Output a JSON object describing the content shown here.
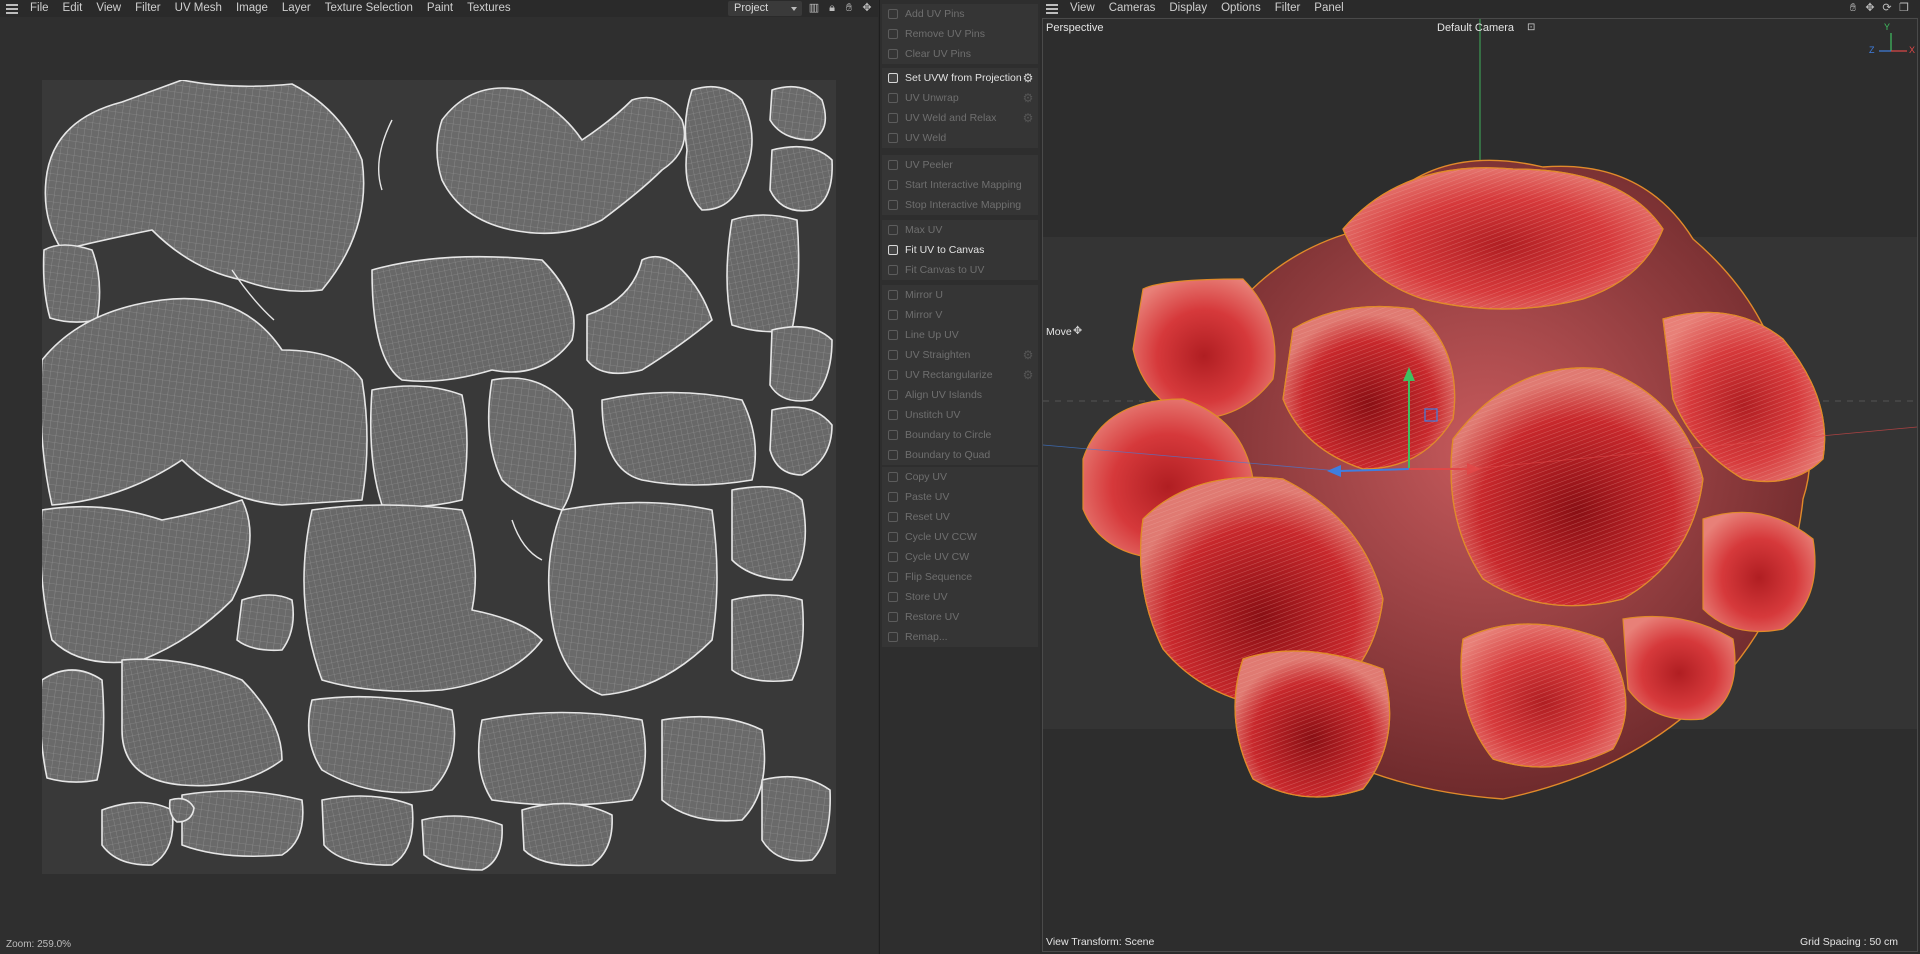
{
  "uv_editor": {
    "menu": [
      "File",
      "Edit",
      "View",
      "Filter",
      "UV Mesh",
      "Image",
      "Layer",
      "Texture Selection",
      "Paint",
      "Textures"
    ],
    "project_select": "Project",
    "status": "Zoom: 259.0%"
  },
  "commands": {
    "group1": [
      {
        "label": "Add UV Pins",
        "enabled": false
      },
      {
        "label": "Remove UV Pins",
        "enabled": false
      },
      {
        "label": "Clear UV Pins",
        "enabled": false
      }
    ],
    "group2": [
      {
        "label": "Set UVW from Projection",
        "enabled": true,
        "gear": true
      },
      {
        "label": "UV Unwrap",
        "enabled": false,
        "gear": true
      },
      {
        "label": "UV Weld and Relax",
        "enabled": false,
        "gear": true
      },
      {
        "label": "UV Weld",
        "enabled": false
      }
    ],
    "group3": [
      {
        "label": "UV Peeler",
        "enabled": false
      },
      {
        "label": "Start Interactive Mapping",
        "enabled": false
      },
      {
        "label": "Stop Interactive Mapping",
        "enabled": false
      }
    ],
    "group4": [
      {
        "label": "Max UV",
        "enabled": false
      },
      {
        "label": "Fit UV to Canvas",
        "enabled": true
      },
      {
        "label": "Fit Canvas to UV",
        "enabled": false
      }
    ],
    "group5": [
      {
        "label": "Mirror U",
        "enabled": false
      },
      {
        "label": "Mirror V",
        "enabled": false
      },
      {
        "label": "Line Up UV",
        "enabled": false
      },
      {
        "label": "UV Straighten",
        "enabled": false,
        "gear": true
      },
      {
        "label": "UV Rectangularize",
        "enabled": false,
        "gear": true
      },
      {
        "label": "Align UV Islands",
        "enabled": false
      },
      {
        "label": "Unstitch UV",
        "enabled": false
      },
      {
        "label": "Boundary to Circle",
        "enabled": false
      },
      {
        "label": "Boundary to Quad",
        "enabled": false
      }
    ],
    "group6": [
      {
        "label": "Copy UV",
        "enabled": false
      },
      {
        "label": "Paste UV",
        "enabled": false
      },
      {
        "label": "Reset UV",
        "enabled": false
      },
      {
        "label": "Cycle UV CCW",
        "enabled": false
      },
      {
        "label": "Cycle UV CW",
        "enabled": false
      },
      {
        "label": "Flip Sequence",
        "enabled": false
      },
      {
        "label": "Store UV",
        "enabled": false
      },
      {
        "label": "Restore UV",
        "enabled": false
      },
      {
        "label": "Remap...",
        "enabled": false
      }
    ]
  },
  "viewport": {
    "menu": [
      "View",
      "Cameras",
      "Display",
      "Options",
      "Filter",
      "Panel"
    ],
    "perspective_label": "Perspective",
    "camera_label": "Default Camera",
    "move_label": "Move",
    "view_transform": "View Transform: Scene",
    "grid_spacing": "Grid Spacing : 50 cm",
    "axis_labels": {
      "y": "Y",
      "z": "Z",
      "x": "X"
    },
    "colors": {
      "object": "#d23a3a",
      "selection_outline": "#e08a2a",
      "axis_x": "#e04848",
      "axis_y": "#3fc060",
      "axis_z": "#3f7ee0"
    }
  }
}
